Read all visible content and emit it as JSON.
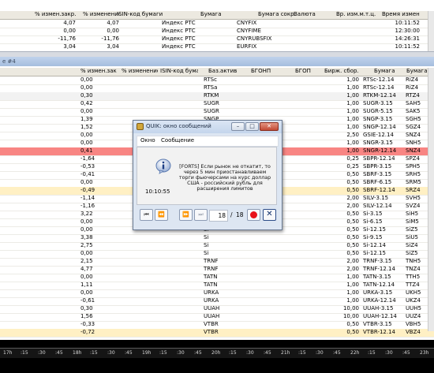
{
  "top_table": {
    "headers": [
      "% измен.закр.",
      "% изменение",
      "ISIN-код бумаги",
      "Бумага",
      "Бумага сокр.",
      "Валюта",
      "Вр. изм.м.т.ц.",
      "Время измен."
    ],
    "rows": [
      [
        "4,07",
        "4,07",
        "",
        "Индекс РТС",
        "CNYFIX",
        "",
        "",
        "10:11:52"
      ],
      [
        "0,00",
        "0,00",
        "",
        "Индекс РТС",
        "CNYFIME",
        "",
        "",
        "12:30:00"
      ],
      [
        "-11,76",
        "-11,76",
        "",
        "Индекс РТС",
        "CNYRUBSFIX",
        "",
        "",
        "14:26:31"
      ],
      [
        "3,04",
        "3,04",
        "",
        "Индекс РТС",
        "EURFIX",
        "",
        "",
        "10:11:52"
      ]
    ]
  },
  "window_tab": {
    "title": "e #4"
  },
  "main_table": {
    "headers": [
      "% измен.закр.",
      "% изменение",
      "ISIN-код бумаги",
      "Баз.актив",
      "БГОНП",
      "БГОП",
      "Бирж. сбор.",
      "Бумага",
      "Бумага..."
    ],
    "rows": [
      {
        "chg_close": "0,00",
        "base": "RTSc",
        "fee": "1,00",
        "sec": "RTSc-12.14",
        "short": "RiZ4",
        "style": ""
      },
      {
        "chg_close": "0,00",
        "base": "RTSa",
        "fee": "1,00",
        "sec": "RTSc-12.14",
        "short": "RiZ4",
        "style": ""
      },
      {
        "chg_close": "0,30",
        "base": "RTKM",
        "fee": "1,00",
        "sec": "RTKM-12.14",
        "short": "RTZ4",
        "style": "sel"
      },
      {
        "chg_close": "0,42",
        "base": "SUGR",
        "fee": "1,00",
        "sec": "SUGR-3.15",
        "short": "SAH5",
        "style": ""
      },
      {
        "chg_close": "0,00",
        "base": "SUGR",
        "fee": "1,00",
        "sec": "SUGR-5.15",
        "short": "SAK5",
        "style": ""
      },
      {
        "chg_close": "1,39",
        "base": "SNGP",
        "fee": "1,00",
        "sec": "SNGP-3.15",
        "short": "SGH5",
        "style": ""
      },
      {
        "chg_close": "1,52",
        "base": "",
        "fee": "1,00",
        "sec": "SNGP-12.14",
        "short": "SGZ4",
        "style": ""
      },
      {
        "chg_close": "0,00",
        "base": "",
        "fee": "2,50",
        "sec": "GSIE-12.14",
        "short": "SNZ4",
        "style": ""
      },
      {
        "chg_close": "0,00",
        "base": "",
        "fee": "1,00",
        "sec": "SNGR-3.15",
        "short": "SNH5",
        "style": ""
      },
      {
        "chg_close": "0,41",
        "base": "",
        "fee": "1,00",
        "sec": "SNGR-12.14",
        "short": "SNZ4",
        "style": "red"
      },
      {
        "chg_close": "-1,64",
        "base": "",
        "fee": "0,25",
        "sec": "SBPR-12.14",
        "short": "SPZ4",
        "style": ""
      },
      {
        "chg_close": "-0,53",
        "base": "",
        "fee": "0,25",
        "sec": "SBPR-3.15",
        "short": "SPH5",
        "style": ""
      },
      {
        "chg_close": "-0,41",
        "base": "",
        "fee": "0,50",
        "sec": "SBRF-3.15",
        "short": "SRH5",
        "style": ""
      },
      {
        "chg_close": "0,00",
        "base": "",
        "fee": "0,50",
        "sec": "SBRF-6.15",
        "short": "SRM5",
        "style": ""
      },
      {
        "chg_close": "-0,49",
        "base": "",
        "fee": "0,50",
        "sec": "SBRF-12.14",
        "short": "SRZ4",
        "style": "yel"
      },
      {
        "chg_close": "-1,14",
        "base": "",
        "fee": "2,00",
        "sec": "SILV-3.15",
        "short": "SVH5",
        "style": ""
      },
      {
        "chg_close": "-1,16",
        "base": "",
        "fee": "2,00",
        "sec": "SILV-12.14",
        "short": "SVZ4",
        "style": ""
      },
      {
        "chg_close": "3,22",
        "base": "Si",
        "fee": "0,50",
        "sec": "Si-3.15",
        "short": "SiH5",
        "style": ""
      },
      {
        "chg_close": "0,00",
        "base": "Si",
        "fee": "0,50",
        "sec": "Si-6.15",
        "short": "SiM5",
        "style": ""
      },
      {
        "chg_close": "0,00",
        "base": "Si",
        "fee": "0,50",
        "sec": "Si-12.15",
        "short": "SiZ5",
        "style": ""
      },
      {
        "chg_close": "3,38",
        "base": "Si",
        "fee": "0,50",
        "sec": "Si-9.15",
        "short": "SiU5",
        "style": ""
      },
      {
        "chg_close": "2,75",
        "base": "Si",
        "fee": "0,50",
        "sec": "Si-12.14",
        "short": "SiZ4",
        "style": ""
      },
      {
        "chg_close": "0,00",
        "base": "Si",
        "fee": "0,50",
        "sec": "Si-12.15",
        "short": "SiZ5",
        "style": ""
      },
      {
        "chg_close": "2,15",
        "base": "TRNF",
        "fee": "2,00",
        "sec": "TRNF-3.15",
        "short": "TNH5",
        "style": ""
      },
      {
        "chg_close": "4,77",
        "base": "TRNF",
        "fee": "2,00",
        "sec": "TRNF-12.14",
        "short": "TNZ4",
        "style": ""
      },
      {
        "chg_close": "0,00",
        "base": "TATN",
        "fee": "1,00",
        "sec": "TATN-3.15",
        "short": "TTH5",
        "style": ""
      },
      {
        "chg_close": "1,11",
        "base": "TATN",
        "fee": "1,00",
        "sec": "TATN-12.14",
        "short": "TTZ4",
        "style": ""
      },
      {
        "chg_close": "0,00",
        "base": "URKA",
        "fee": "1,00",
        "sec": "URKA-3.15",
        "short": "UKH5",
        "style": ""
      },
      {
        "chg_close": "-0,61",
        "base": "URKA",
        "fee": "1,00",
        "sec": "URKA-12.14",
        "short": "UKZ4",
        "style": ""
      },
      {
        "chg_close": "0,30",
        "base": "UUAH",
        "fee": "10,00",
        "sec": "UUAH-3.15",
        "short": "UUH5",
        "style": ""
      },
      {
        "chg_close": "1,56",
        "base": "UUAH",
        "fee": "10,00",
        "sec": "UUAH-12.14",
        "short": "UUZ4",
        "style": ""
      },
      {
        "chg_close": "-0,33",
        "base": "VTBR",
        "fee": "0,50",
        "sec": "VTBR-3.15",
        "short": "VBH5",
        "style": ""
      },
      {
        "chg_close": "-0,72",
        "base": "VTBR",
        "fee": "0,50",
        "sec": "VTBR-12.14",
        "short": "VBZ4",
        "style": "yel"
      }
    ]
  },
  "timeline": {
    "labels": [
      "17h",
      ":15",
      ":30",
      ":45",
      "18h",
      ":15",
      ":30",
      ":45",
      "19h",
      ":15",
      ":30",
      ":45",
      "20h",
      ":15",
      ":30",
      ":45",
      "21h",
      ":15",
      ":30",
      ":45",
      "22h",
      ":15",
      ":30",
      ":45",
      "23h"
    ]
  },
  "dialog": {
    "title": "QUIK: окно сообщений",
    "menu": [
      "Окно",
      "Сообщение"
    ],
    "time": "10:10:55",
    "message": "[FORTS] Если рынок не откатит, то через 5 мин приостанавливаем торги фьючерсами на курс доллар США - российский рубль для расширения лимитов",
    "counter_current": "18",
    "counter_sep": "/",
    "counter_total": "18",
    "buttons": {
      "minimize": "–",
      "maximize": "□",
      "close": "✕"
    }
  }
}
